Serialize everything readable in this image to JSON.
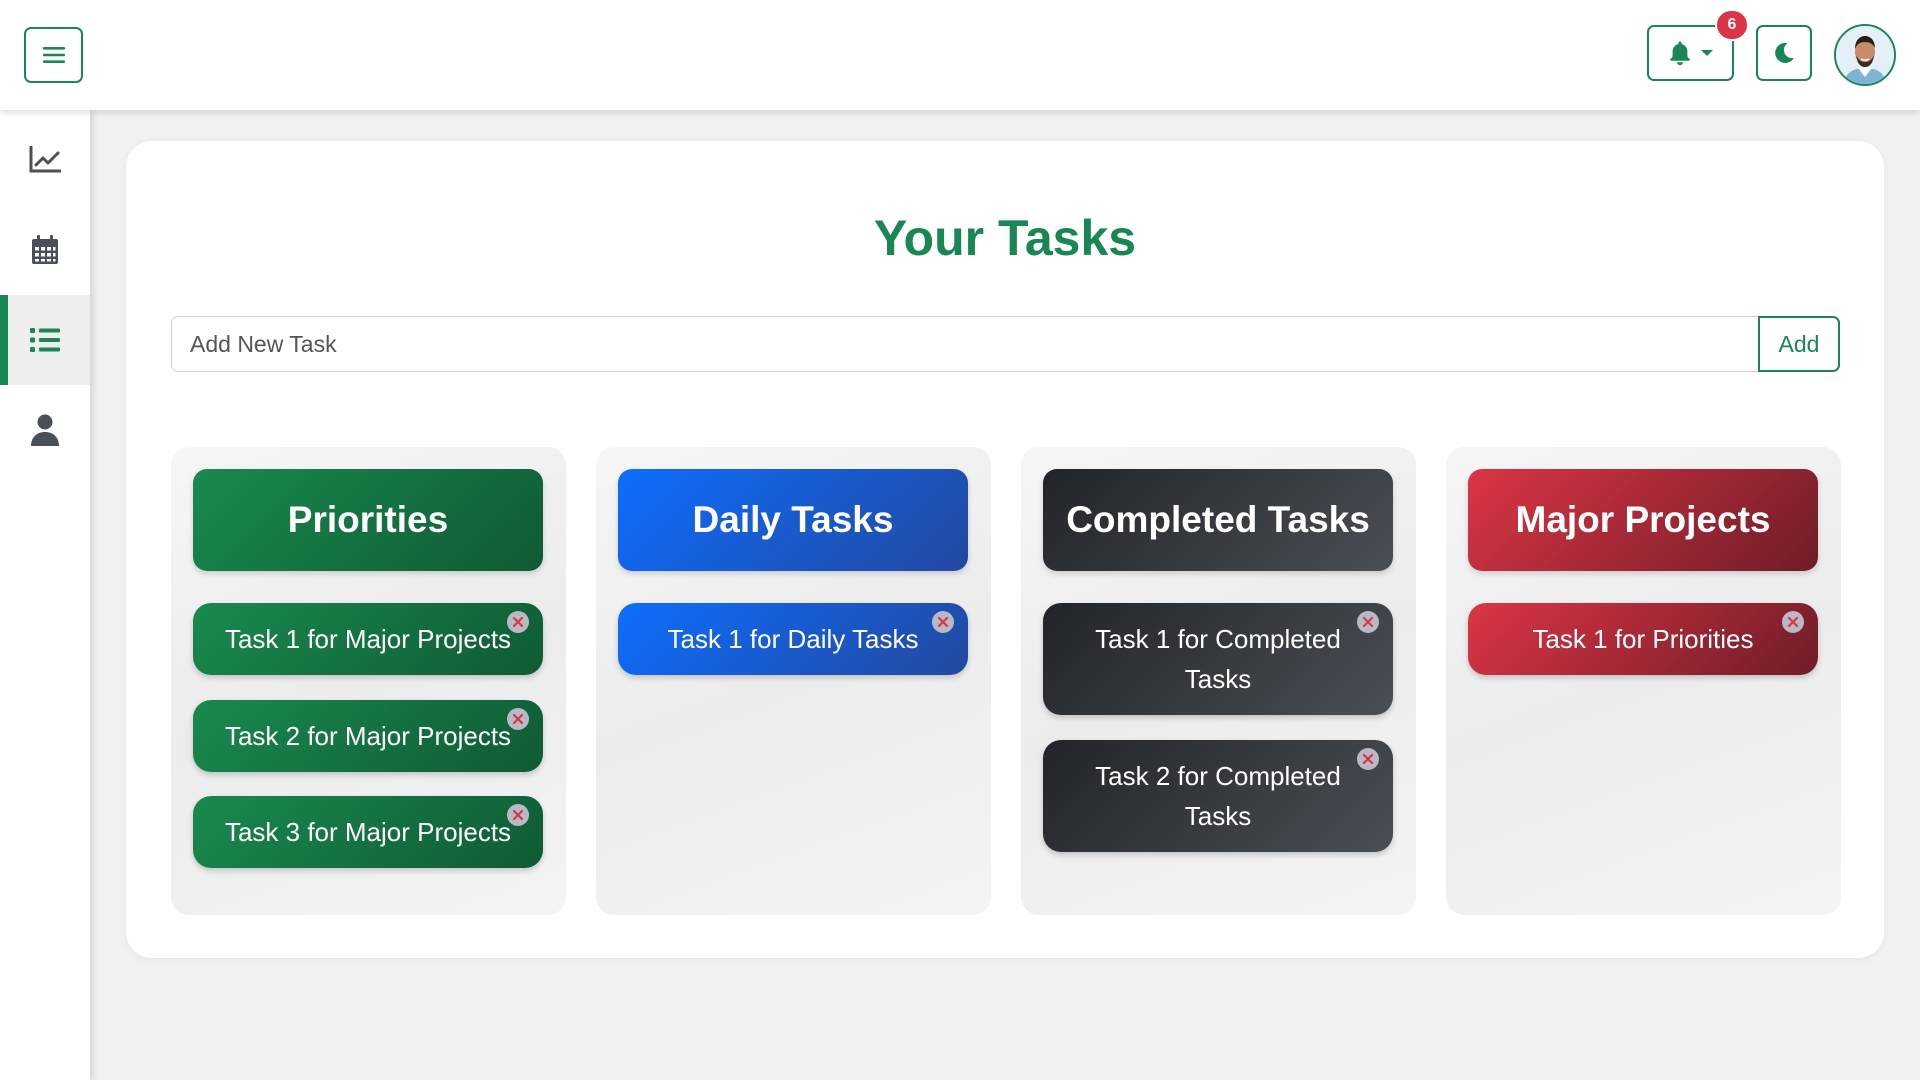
{
  "header": {
    "notification_count": "6"
  },
  "sidebar": {
    "items": [
      {
        "icon": "chart-line-icon"
      },
      {
        "icon": "calendar-icon"
      },
      {
        "icon": "list-icon",
        "active": true
      },
      {
        "icon": "user-icon"
      }
    ]
  },
  "main": {
    "title": "Your Tasks",
    "input_placeholder": "Add New Task",
    "add_label": "Add",
    "columns": [
      {
        "title": "Priorities",
        "color": "#198754",
        "tasks": [
          "Task 1 for Major Projects",
          "Task 2 for Major Projects",
          "Task 3 for Major Projects"
        ]
      },
      {
        "title": "Daily Tasks",
        "color": "#0d6efd",
        "tasks": [
          "Task 1 for Daily Tasks"
        ]
      },
      {
        "title": "Completed Tasks",
        "color": "#212529",
        "tasks": [
          "Task 1 for Completed Tasks",
          "Task 2 for Completed Tasks"
        ]
      },
      {
        "title": "Major Projects",
        "color": "#dc3545",
        "tasks": [
          "Task 1 for Priorities"
        ]
      }
    ]
  },
  "colors": {
    "accent": "#198754",
    "badge": "#dc3545"
  }
}
